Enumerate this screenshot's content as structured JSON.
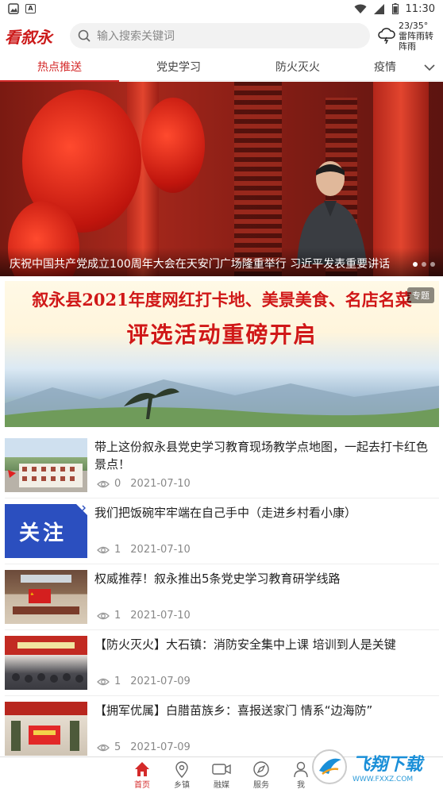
{
  "status": {
    "time": "11:30",
    "left_box": "A"
  },
  "header": {
    "logo": "看叙永",
    "search_placeholder": "输入搜索关键词",
    "weather_temp": "23/35°",
    "weather_desc1": "雷阵雨转",
    "weather_desc2": "阵雨"
  },
  "tabs": [
    "热点推送",
    "党史学习",
    "防火灭火",
    "疫情"
  ],
  "hero": {
    "caption": "庆祝中国共产党成立100周年大会在天安门广场隆重举行 习近平发表重要讲话"
  },
  "banner": {
    "line1": "叙永县2021年度网红打卡地、美景美食、名店名菜",
    "line2": "评选活动重磅开启",
    "tag": "专题"
  },
  "news": [
    {
      "title": "带上这份叙永县党史学习教育现场教学点地图，一起去打卡红色景点！",
      "views": "0",
      "date": "2021-07-10"
    },
    {
      "title": "我们把饭碗牢牢端在自己手中（走进乡村看小康）",
      "views": "1",
      "date": "2021-07-10",
      "thumb_text": "关注"
    },
    {
      "title": "权威推荐！叙永推出5条党史学习教育研学线路",
      "views": "1",
      "date": "2021-07-10"
    },
    {
      "title": "【防火灭火】大石镇：消防安全集中上课 培训到人是关键",
      "views": "1",
      "date": "2021-07-09"
    },
    {
      "title": "【拥军优属】白腊苗族乡：喜报送家门 情系“边海防”",
      "views": "5",
      "date": "2021-07-09"
    }
  ],
  "nav": [
    "首页",
    "乡镇",
    "融媒",
    "服务",
    "我"
  ],
  "watermark": {
    "title": "飞翔下载",
    "url": "WWW.FXXZ.COM"
  },
  "colors": {
    "accent": "#d42a2a"
  }
}
